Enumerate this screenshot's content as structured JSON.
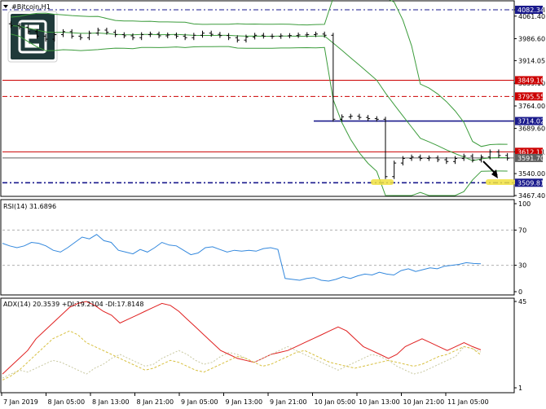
{
  "header": {
    "symbol": "#Bitcoin,H1"
  },
  "price_chart": {
    "type": "candlestick",
    "axis_ticks": [
      "4082.34",
      "4061.40",
      "3986.60",
      "3914.05",
      "3839.10",
      "3764.00",
      "3689.60",
      "3612.11",
      "3540.00",
      "3467.40"
    ],
    "price_range": [
      3467.4,
      4082.34
    ],
    "level_tags": [
      {
        "value": "4082.34",
        "color": "#1a1a8c"
      },
      {
        "value": "3849.16",
        "color": "#cc0000"
      },
      {
        "value": "3795.55",
        "color": "#cc0000"
      },
      {
        "value": "3714.02",
        "color": "#1a1a8c"
      },
      {
        "value": "3612.11",
        "color": "#cc0000"
      },
      {
        "value": "3591.70",
        "color": "#606060"
      },
      {
        "value": "3509.81",
        "color": "#1a1a8c"
      }
    ]
  },
  "chart_data": [
    {
      "type": "line",
      "title": "",
      "ylim": [
        3467.4,
        4082.34
      ],
      "series": [
        {
          "values": [
            4030,
            4025,
            4010,
            3995,
            3985,
            4000,
            4010,
            3995,
            3990,
            4005,
            4015,
            4008,
            4000,
            3996,
            3990,
            4000,
            4002,
            3996,
            3999,
            3995,
            3990,
            3998,
            4005,
            4001,
            3997,
            3990,
            3982,
            3992,
            3998,
            3995,
            3994,
            3996,
            3997,
            3999,
            4000,
            4002,
            3998,
            3720,
            3728,
            3730,
            3726,
            3722,
            3720,
            3530,
            3575,
            3590,
            3595,
            3590,
            3592,
            3586,
            3580,
            3590,
            3598,
            3585,
            3595,
            3612,
            3600,
            3591
          ]
        }
      ]
    },
    {
      "type": "line",
      "title": "RSI(14) 31.6896",
      "ylim": [
        0,
        100
      ],
      "levels": [
        70,
        30
      ],
      "series": [
        {
          "values": [
            55,
            52,
            50,
            52,
            56,
            55,
            52,
            47,
            45,
            50,
            56,
            62,
            60,
            65,
            58,
            56,
            47,
            45,
            43,
            48,
            45,
            50,
            56,
            53,
            52,
            47,
            42,
            44,
            50,
            51,
            48,
            45,
            47,
            46,
            47,
            46,
            49,
            50,
            48,
            15,
            14,
            13,
            15,
            16,
            13,
            12,
            14,
            17,
            15,
            18,
            20,
            19,
            22,
            20,
            19,
            24,
            26,
            23,
            25,
            27,
            26,
            29,
            30,
            31,
            33,
            32,
            31.7
          ]
        }
      ]
    },
    {
      "type": "line",
      "title": "ADX(14) 20.3539 +DI:19.2104 -DI:17.8148",
      "ylim": [
        1,
        45
      ],
      "series": [
        {
          "values": [
            8,
            12,
            16,
            20,
            26,
            30,
            34,
            38,
            42,
            44,
            45,
            43,
            40,
            38,
            34,
            36,
            38,
            40,
            42,
            44,
            43,
            40,
            36,
            32,
            28,
            24,
            20,
            18,
            16,
            15,
            14,
            16,
            18,
            19,
            20,
            22,
            24,
            26,
            28,
            30,
            32,
            30,
            26,
            22,
            20,
            18,
            16,
            18,
            22,
            24,
            26,
            24,
            22,
            20,
            22,
            24,
            22,
            20.35
          ]
        },
        {
          "values": [
            6,
            8,
            10,
            9,
            11,
            13,
            15,
            14,
            12,
            10,
            8,
            11,
            13,
            16,
            18,
            16,
            14,
            12,
            13,
            16,
            18,
            20,
            18,
            15,
            13,
            14,
            17,
            19,
            18,
            16,
            14,
            16,
            18,
            20,
            22,
            20,
            18,
            16,
            14,
            12,
            10,
            12,
            14,
            16,
            18,
            17,
            15,
            12,
            10,
            8,
            9,
            11,
            13,
            15,
            17,
            22,
            21,
            19.21
          ]
        },
        {
          "values": [
            5,
            7,
            10,
            14,
            18,
            22,
            26,
            28,
            30,
            28,
            24,
            22,
            20,
            18,
            16,
            14,
            12,
            10,
            11,
            13,
            15,
            14,
            12,
            10,
            9,
            11,
            13,
            15,
            17,
            16,
            14,
            12,
            13,
            15,
            17,
            19,
            20,
            18,
            16,
            14,
            13,
            12,
            11,
            12,
            13,
            14,
            15,
            14,
            13,
            12,
            13,
            15,
            17,
            18,
            20,
            22,
            21,
            17.81
          ]
        }
      ]
    }
  ],
  "panels": {
    "rsi": {
      "label": "RSI(14) 31.6896",
      "ticks": [
        "100",
        "70",
        "30",
        "0"
      ]
    },
    "adx": {
      "label": "ADX(14) 20.3539 +DI:19.2104 -DI:17.8148",
      "ticks": [
        "45",
        "1"
      ]
    }
  },
  "time_axis": [
    "7 Jan 2019",
    "8 Jan 05:00",
    "8 Jan 13:00",
    "8 Jan 21:00",
    "9 Jan 05:00",
    "9 Jan 13:00",
    "9 Jan 21:00",
    "10 Jan 05:00",
    "10 Jan 13:00",
    "10 Jan 21:00",
    "11 Jan 05:00"
  ],
  "colors": {
    "bollinger": "#3c9c3c",
    "rsi": "#3388dd",
    "adx": "#e02020",
    "plus_di": "#c8c8a0",
    "minus_di": "#d8c040",
    "level_red": "#cc0000",
    "level_blue": "#1a1a8c",
    "highlight": "#f0e040"
  }
}
